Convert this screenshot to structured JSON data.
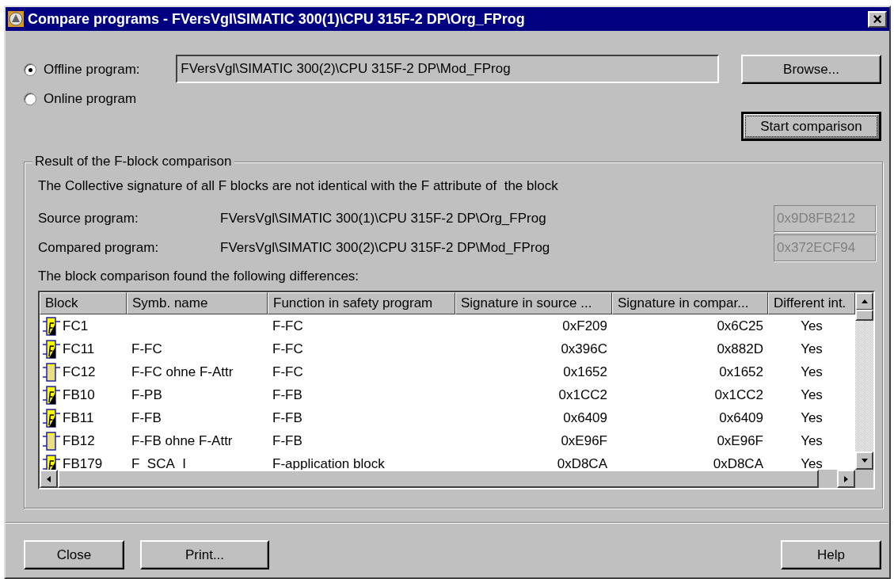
{
  "window": {
    "title": "Compare programs - FVersVgl\\SIMATIC 300(1)\\CPU 315F-2 DP\\Org_FProg",
    "close": "×"
  },
  "source_options": [
    {
      "label": "Offline program:",
      "selected": true
    },
    {
      "label": "Online program",
      "selected": false
    }
  ],
  "offline_path": "FVersVgl\\SIMATIC 300(2)\\CPU 315F-2 DP\\Mod_FProg",
  "browse_button": "Browse...",
  "start_button": {
    "label": "Start comparison",
    "focused": true
  },
  "result": {
    "title": "Result of the F-block comparison",
    "message": "The Collective signature of all F blocks are not identical with the F attribute of  the block",
    "programs": [
      {
        "label": "Source program:",
        "path": "FVersVgl\\SIMATIC 300(1)\\CPU 315F-2 DP\\Org_FProg",
        "signature": "0x9D8FB212"
      },
      {
        "label": "Compared program:",
        "path": "FVersVgl\\SIMATIC 300(2)\\CPU 315F-2 DP\\Mod_FProg",
        "signature": "0x372ECF94"
      }
    ],
    "differences_label": "The block comparison found the following differences:",
    "table": {
      "columns": [
        "Block",
        "Symb. name",
        "Function in safety program",
        "Signature in source ...",
        "Signature in compar...",
        "Different int."
      ],
      "rows": [
        {
          "kind": "f_block",
          "cells": [
            "FC1",
            "",
            "F-FC",
            "0xF209",
            "0x6C25",
            "Yes"
          ]
        },
        {
          "kind": "f_block",
          "cells": [
            "FC11",
            "F-FC",
            "F-FC",
            "0x396C",
            "0x882D",
            "Yes"
          ]
        },
        {
          "kind": "plain_block",
          "cells": [
            "FC12",
            "F-FC ohne F-Attr",
            "F-FC",
            "0x1652",
            "0x1652",
            "Yes"
          ]
        },
        {
          "kind": "f_block",
          "cells": [
            "FB10",
            "F-PB",
            "F-FB",
            "0x1CC2",
            "0x1CC2",
            "Yes"
          ]
        },
        {
          "kind": "f_block",
          "cells": [
            "FB11",
            "F-FB",
            "F-FB",
            "0x6409",
            "0x6409",
            "Yes"
          ]
        },
        {
          "kind": "plain_block",
          "cells": [
            "FB12",
            "F-FB ohne F-Attr",
            "F-FB",
            "0xE96F",
            "0xE96F",
            "Yes"
          ]
        },
        {
          "kind": "f_block",
          "cells": [
            "FB179",
            "F_SCA_I",
            "F-application block",
            "0xD8CA",
            "0xD8CA",
            "Yes"
          ]
        }
      ]
    }
  },
  "buttons": [
    "Close",
    "Print...",
    "Help"
  ]
}
